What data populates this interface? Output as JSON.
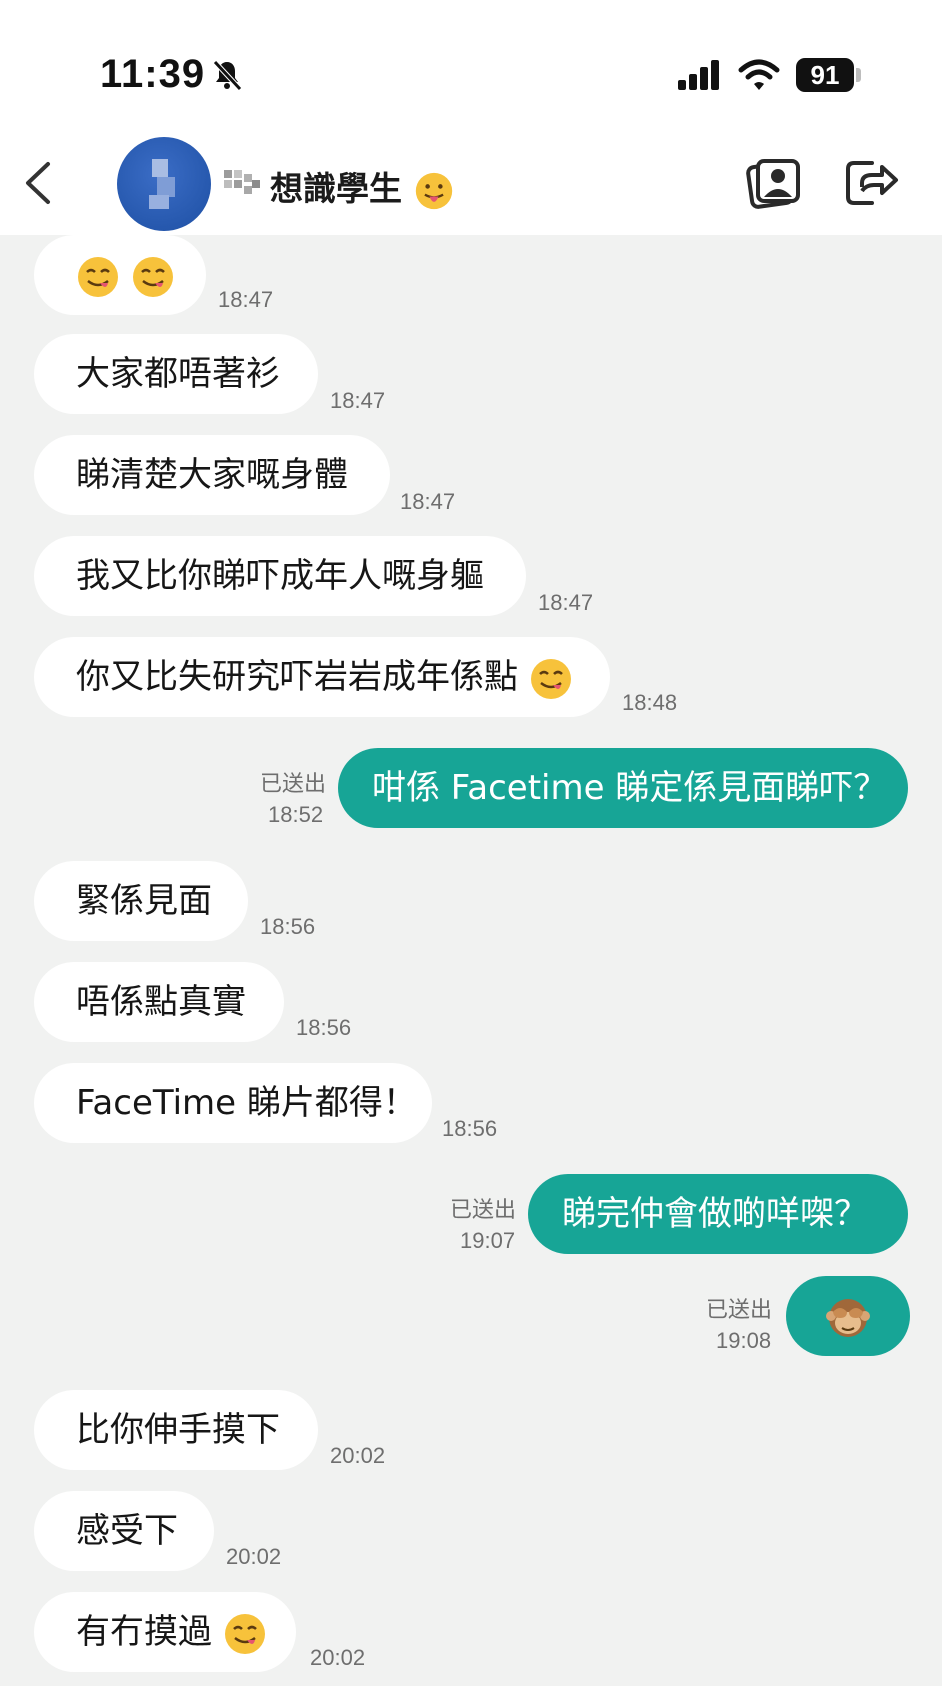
{
  "status_bar": {
    "time": "11:39",
    "battery": "91",
    "silent_icon": "bell-slash-icon",
    "signal_icon": "signal-icon",
    "wifi_icon": "wifi-icon"
  },
  "header": {
    "title": "想識學生",
    "back_icon": "chevron-left-icon",
    "gallery_icon": "photo-album-icon",
    "leave_icon": "exit-icon"
  },
  "colors": {
    "outgoing_bubble": "#17a596",
    "incoming_bubble": "#ffffff",
    "background": "#f1f2f1"
  },
  "messages": [
    {
      "dir": "in",
      "text": "",
      "emoji": [
        "yum-face",
        "yum-face"
      ],
      "time": "18:47"
    },
    {
      "dir": "in",
      "text": "大家都唔著衫",
      "time": "18:47"
    },
    {
      "dir": "in",
      "text": "睇清楚大家嘅身體",
      "time": "18:47"
    },
    {
      "dir": "in",
      "text": "我又比你睇吓成年人嘅身軀",
      "time": "18:47"
    },
    {
      "dir": "in",
      "text": "你又比失研究吓岩岩成年係點",
      "emoji": [
        "yum-face"
      ],
      "time": "18:48"
    },
    {
      "dir": "out",
      "text": "咁係 Facetime 睇定係見面睇吓？",
      "status": "已送出",
      "time": "18:52"
    },
    {
      "dir": "in",
      "text": "緊係見面",
      "time": "18:56"
    },
    {
      "dir": "in",
      "text": "唔係點真實",
      "time": "18:56"
    },
    {
      "dir": "in",
      "text": "FaceTime 睇片都得！",
      "time": "18:56"
    },
    {
      "dir": "out",
      "text": "睇完仲會做啲咩㗎？",
      "status": "已送出",
      "time": "19:07"
    },
    {
      "dir": "out",
      "text": "",
      "emoji": [
        "see-no-evil-monkey"
      ],
      "status": "已送出",
      "time": "19:08"
    },
    {
      "dir": "in",
      "text": "比你伸手摸下",
      "time": "20:02"
    },
    {
      "dir": "in",
      "text": "感受下",
      "time": "20:02"
    },
    {
      "dir": "in",
      "text": "有冇摸過",
      "emoji": [
        "yum-face"
      ],
      "time": "20:02"
    }
  ]
}
